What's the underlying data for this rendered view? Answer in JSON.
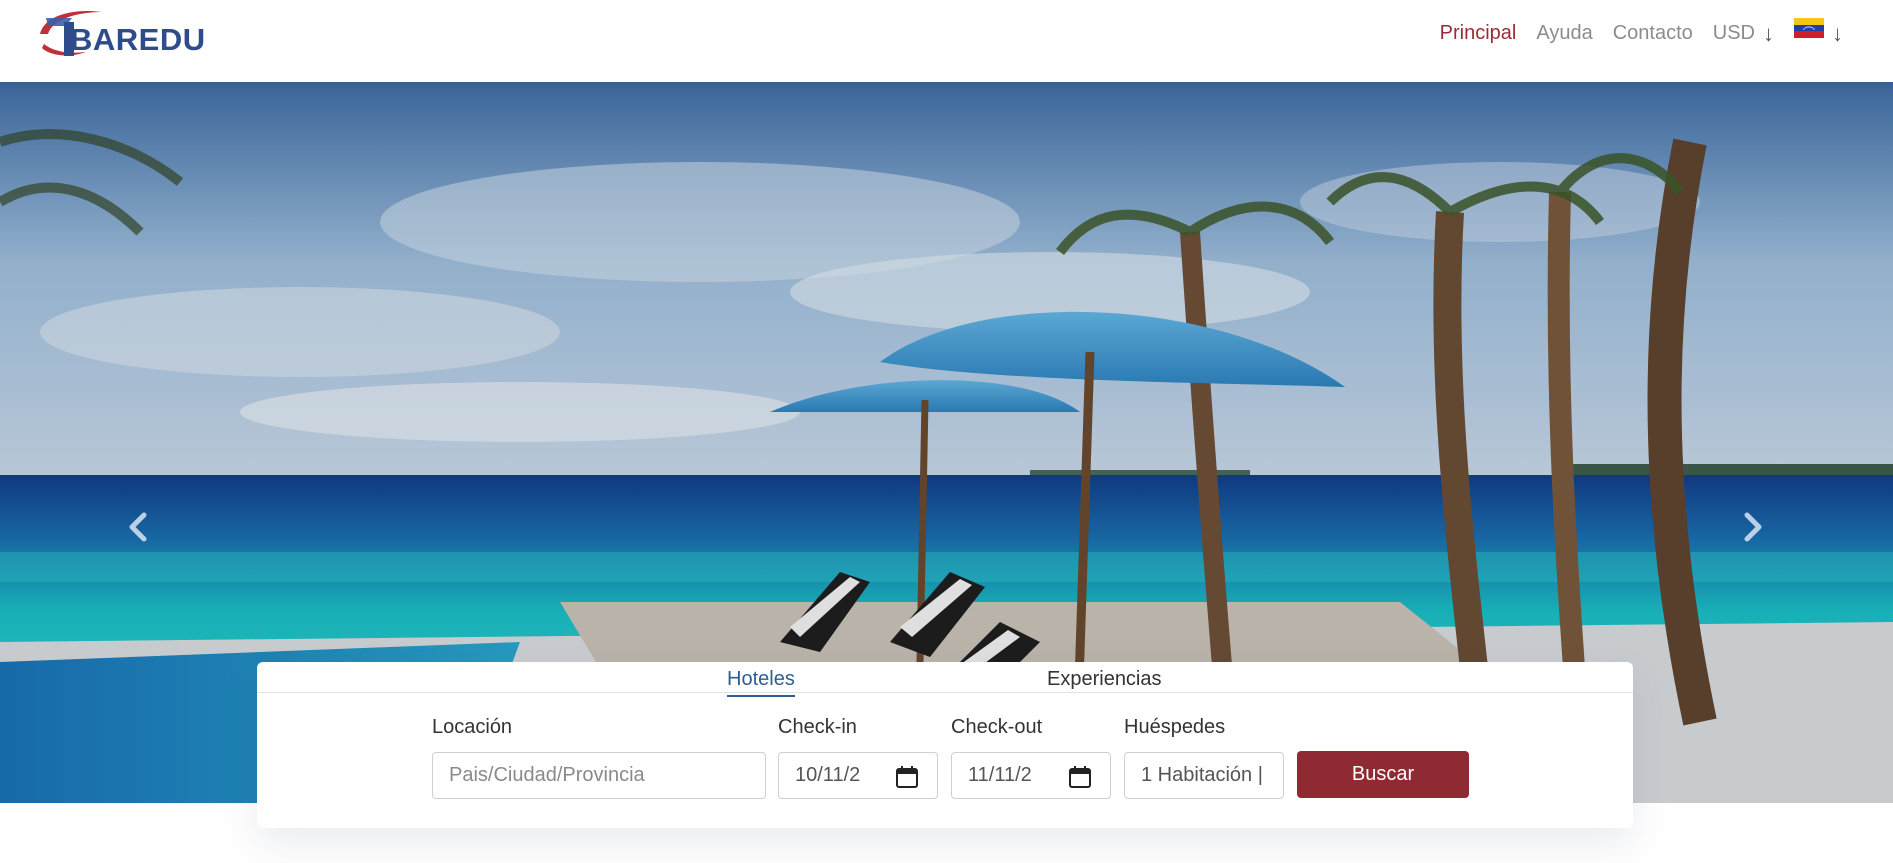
{
  "header": {
    "logo_text": "BAREDU",
    "nav": {
      "principal": "Principal",
      "ayuda": "Ayuda",
      "contacto": "Contacto",
      "currency": "USD",
      "arrow": "↓"
    },
    "colors": {
      "active": "#9b2b35",
      "inactive": "#8c8c8c",
      "brand": "#2e4c8c"
    }
  },
  "hero": {
    "prev_icon": "chevron-left-icon",
    "next_icon": "chevron-right-icon"
  },
  "search": {
    "tabs": [
      {
        "label": "Hoteles",
        "active": true
      },
      {
        "label": "Experiencias",
        "active": false
      }
    ],
    "location": {
      "label": "Locación",
      "placeholder": "Pais/Ciudad/Provincia"
    },
    "checkin": {
      "label": "Check-in",
      "value": "10/11/2"
    },
    "checkout": {
      "label": "Check-out",
      "value": "11/11/2"
    },
    "guests": {
      "label": "Huéspedes",
      "value": "1 Habitación |"
    },
    "button": "Buscar",
    "colors": {
      "button": "#8f2a33",
      "tab_active": "#2f5d95"
    }
  }
}
